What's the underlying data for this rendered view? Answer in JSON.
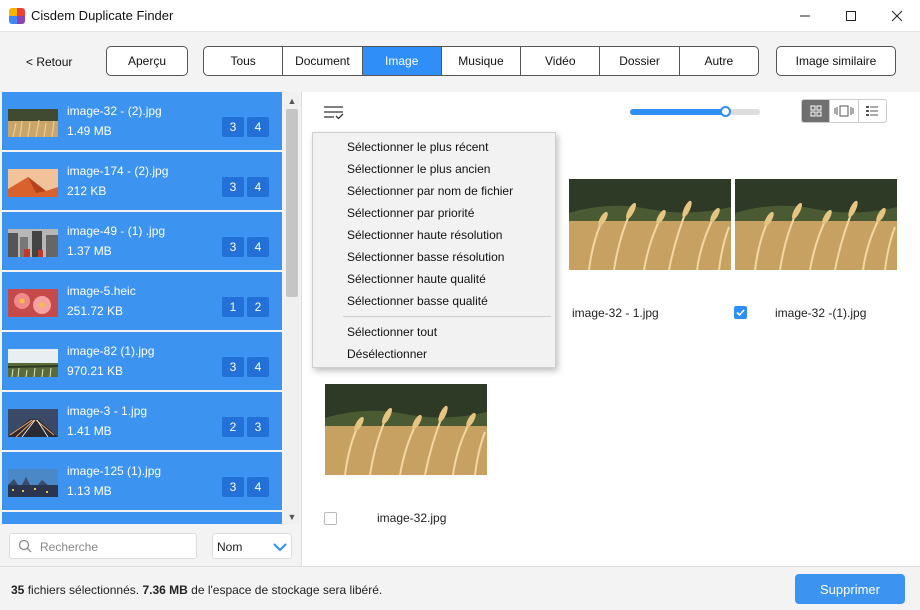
{
  "window": {
    "title": "Cisdem Duplicate Finder"
  },
  "toolbar": {
    "back_label": "< Retour",
    "preview_label": "Aperçu",
    "tabs": [
      {
        "label": "Tous"
      },
      {
        "label": "Document"
      },
      {
        "label": "Image",
        "active": true
      },
      {
        "label": "Musique"
      },
      {
        "label": "Vidéo"
      },
      {
        "label": "Dossier"
      },
      {
        "label": "Autre"
      }
    ],
    "similar_label": "Image similaire"
  },
  "sidebar": {
    "items": [
      {
        "name": "image-32 - (2).jpg",
        "size": "1.49 MB",
        "a": "3",
        "b": "4",
        "thumb": "wheat"
      },
      {
        "name": "image-174 - (2).jpg",
        "size": "212 KB",
        "a": "3",
        "b": "4",
        "thumb": "desert"
      },
      {
        "name": "image-49 - (1)  .jpg",
        "size": "1.37 MB",
        "a": "3",
        "b": "4",
        "thumb": "street"
      },
      {
        "name": "image-5.heic",
        "size": "251.72 KB",
        "a": "1",
        "b": "2",
        "thumb": "flowers"
      },
      {
        "name": "image-82 (1).jpg",
        "size": "970.21 KB",
        "a": "3",
        "b": "4",
        "thumb": "field"
      },
      {
        "name": "image-3 - 1.jpg",
        "size": "1.41 MB",
        "a": "2",
        "b": "3",
        "thumb": "road"
      },
      {
        "name": "image-125 (1).jpg",
        "size": "1.13 MB",
        "a": "3",
        "b": "4",
        "thumb": "city"
      }
    ],
    "search_placeholder": "Recherche",
    "sort_value": "Nom"
  },
  "main": {
    "zoom_fraction": 0.73,
    "cards": [
      {
        "name": "image-32 - 1.jpg",
        "checked": false
      },
      {
        "name": "image-32 -(1).jpg",
        "checked": true
      },
      {
        "name": "image-32.jpg",
        "checked": false
      }
    ]
  },
  "menu": {
    "items": [
      "Sélectionner le plus récent",
      "Sélectionner le plus ancien",
      "Sélectionner par nom de fichier",
      "Sélectionner par priorité",
      "Sélectionner haute résolution",
      "Sélectionner basse résolution",
      "Sélectionner haute qualité",
      "Sélectionner basse qualité"
    ],
    "select_all": "Sélectionner tout",
    "deselect": "Désélectionner"
  },
  "status": {
    "count": "35",
    "count_label": "fichiers sélectionnés.",
    "size": "7.36 MB",
    "size_label": "de l'espace de stockage sera libéré.",
    "delete_label": "Supprimer"
  },
  "colors": {
    "accent": "#2f8ef7",
    "list_item": "#3d93f0",
    "badge": "#2270d8"
  }
}
